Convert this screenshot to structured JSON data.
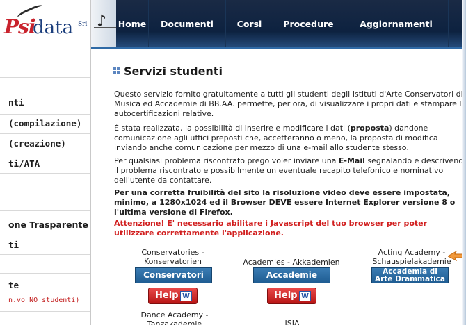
{
  "logo": {
    "psi": "Psi",
    "data": "data",
    "srl": "Srl"
  },
  "nav": [
    "Home",
    "Documenti",
    "Corsi",
    "Procedure",
    "Aggiornamenti"
  ],
  "sidebar": {
    "items": [
      "nti",
      "(compilazione)",
      "(creazione)",
      "ti/ATA",
      "one Trasparente",
      "ti",
      "te",
      "n.vo NO studenti)"
    ]
  },
  "main": {
    "title": "Servizi studenti",
    "p1": "Questo servizio fornito gratuitamente a tutti gli studenti degli Istituti d'Arte Conservatori di Musica ed Accademie di BB.AA. permette, per ora, di visualizzare i propri dati e stampare le autocertificazioni relative.",
    "p2_before": "È stata realizzata, la possibilità di inserire e modificare i dati (",
    "p2_bold": "proposta",
    "p2_after": ") dandone comunicazione agli uffici preposti che, accetteranno o meno, la proposta di modifica inviando anche comunicazione per mezzo di una e-mail allo studente stesso.",
    "p3_before": "Per qualsiasi problema riscontrato prego voler inviare una ",
    "p3_bold": "E-Mail",
    "p3_after": " segnalando e descrivendo il problema riscontrato e possibilmente un eventuale recapito telefonico e nominativo dell'utente da contattare.",
    "p4_before": "Per una corretta fruibilità del sito la risoluzione video deve essere impostata, minimo, a 1280x1024 ed il Browser ",
    "p4_under": "DEVE",
    "p4_after": " essere Internet Explorer versione 8 o l'ultima versione di Firefox.",
    "warning": "Attenzione! E' necessario abilitare i Javascript del tuo browser per poter utilizzare correttamente l'applicazione."
  },
  "institutes": {
    "conservatori": {
      "label_1": "Conservatories -",
      "label_2": "Konservatorien",
      "button": "Conservatori"
    },
    "accademie": {
      "label_1": "Academies - Akkademien",
      "button": "Accademie"
    },
    "arte_drammatica": {
      "label_1": "Acting Academy -",
      "label_2": "Schauspielakademie",
      "button_1": "Accademia di",
      "button_2": "Arte Drammatica"
    },
    "danza": {
      "label_1": "Dance Academy -",
      "label_2": "Tanzakademie"
    },
    "isia": {
      "label_1": "ISIA"
    },
    "help_label": "Help",
    "help_icon": "W"
  }
}
